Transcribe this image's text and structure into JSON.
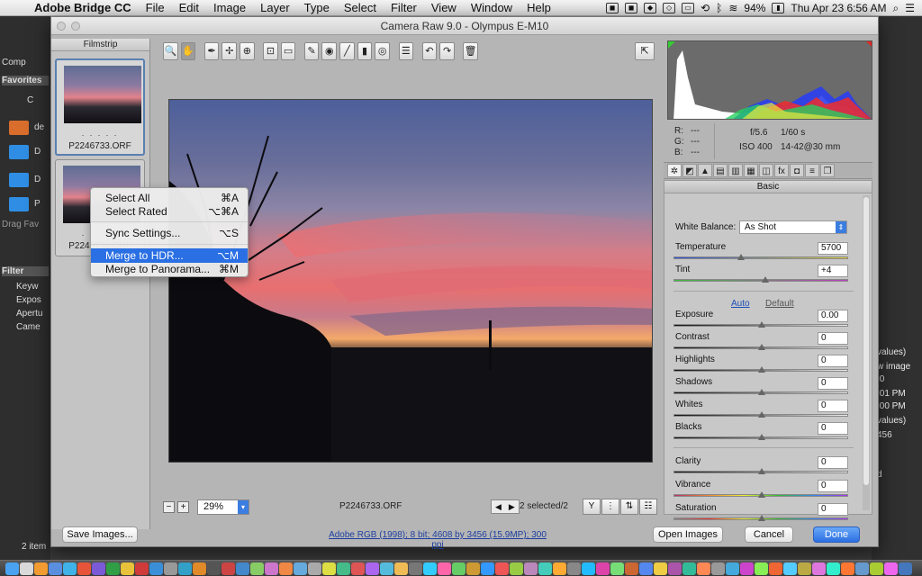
{
  "menubar": {
    "app_name": "Adobe Bridge CC",
    "items": [
      "File",
      "Edit",
      "Image",
      "Layer",
      "Type",
      "Select",
      "Filter",
      "View",
      "Window",
      "Help"
    ],
    "battery": "94%",
    "datetime": "Thu Apr 23  6:56 AM"
  },
  "bridge": {
    "sidebar": [
      "Comp",
      "Favorites",
      "C",
      "de",
      "D",
      "D",
      "P",
      "Drag Fav"
    ],
    "filter_tab": "Filter",
    "filter_rows": [
      "Keyw",
      "Expos",
      "Apertu",
      "Came"
    ],
    "status": "2 item",
    "right_text": [
      "values)",
      "w image",
      ".0",
      ":01 PM",
      ":00 PM",
      "values)",
      "456",
      "d"
    ]
  },
  "window": {
    "title": "Camera Raw 9.0  -  Olympus E-M10"
  },
  "filmstrip": {
    "header": "Filmstrip",
    "thumbs": [
      {
        "name": "P2246733.ORF",
        "dots": ". . . . ."
      },
      {
        "name": "P2246733.ORF",
        "dots": ". . . . ."
      }
    ]
  },
  "toolbar": {
    "tools": [
      {
        "name": "zoom-tool",
        "glyph": "🔍"
      },
      {
        "name": "hand-tool",
        "glyph": "✋"
      },
      {
        "name": "white-balance-tool",
        "glyph": "✒"
      },
      {
        "name": "color-sampler-tool",
        "glyph": "✢"
      },
      {
        "name": "targeted-adjustment-tool",
        "glyph": "⊕"
      },
      {
        "name": "crop-tool",
        "glyph": "⊡"
      },
      {
        "name": "straighten-tool",
        "glyph": "▭"
      },
      {
        "name": "spot-removal-tool",
        "glyph": "✎"
      },
      {
        "name": "red-eye-tool",
        "glyph": "◉"
      },
      {
        "name": "adjustment-brush-tool",
        "glyph": "╱"
      },
      {
        "name": "graduated-filter-tool",
        "glyph": "▮"
      },
      {
        "name": "radial-filter-tool",
        "glyph": "◎"
      },
      {
        "name": "preferences-tool",
        "glyph": "☰"
      },
      {
        "name": "rotate-left-tool",
        "glyph": "↶"
      },
      {
        "name": "rotate-right-tool",
        "glyph": "↷"
      },
      {
        "name": "trash-tool",
        "glyph": "🗑"
      }
    ]
  },
  "preview": {
    "zoom": "29%",
    "filename": "P2246733.ORF",
    "selection": "2 selected/2"
  },
  "histogram_info": {
    "r": "R:",
    "g": "G:",
    "b": "B:",
    "r_val": "---",
    "g_val": "---",
    "b_val": "---",
    "aperture": "f/5.6",
    "shutter": "1/60 s",
    "iso": "ISO 400",
    "lens": "14-42@30 mm"
  },
  "panel": {
    "title": "Basic",
    "wb_label": "White Balance:",
    "wb_value": "As Shot",
    "auto": "Auto",
    "default": "Default",
    "sliders": [
      {
        "label": "Temperature",
        "value": "5700",
        "pos": 0.38
      },
      {
        "label": "Tint",
        "value": "+4",
        "pos": 0.52
      },
      {
        "label": "Exposure",
        "value": "0.00",
        "pos": 0.5
      },
      {
        "label": "Contrast",
        "value": "0",
        "pos": 0.5
      },
      {
        "label": "Highlights",
        "value": "0",
        "pos": 0.5
      },
      {
        "label": "Shadows",
        "value": "0",
        "pos": 0.5
      },
      {
        "label": "Whites",
        "value": "0",
        "pos": 0.5
      },
      {
        "label": "Blacks",
        "value": "0",
        "pos": 0.5
      },
      {
        "label": "Clarity",
        "value": "0",
        "pos": 0.5
      },
      {
        "label": "Vibrance",
        "value": "0",
        "pos": 0.5
      },
      {
        "label": "Saturation",
        "value": "0",
        "pos": 0.5
      }
    ]
  },
  "context_menu": {
    "items": [
      {
        "label": "Select All",
        "shortcut": "⌘A"
      },
      {
        "label": "Select Rated",
        "shortcut": "⌥⌘A"
      },
      {
        "label": "Sync Settings...",
        "shortcut": "⌥S"
      },
      {
        "label": "Merge to HDR...",
        "shortcut": "⌥M"
      },
      {
        "label": "Merge to Panorama...",
        "shortcut": "⌘M"
      }
    ]
  },
  "footer": {
    "save": "Save Images...",
    "workflow": "Adobe RGB (1998); 8 bit; 4608 by 3456 (15.9MP); 300 ppi",
    "open": "Open Images",
    "cancel": "Cancel",
    "done": "Done"
  },
  "colors": {
    "accent": "#2a6fe3",
    "panel_bg": "#c8c8c8",
    "sky_pink": "#e86f70"
  }
}
